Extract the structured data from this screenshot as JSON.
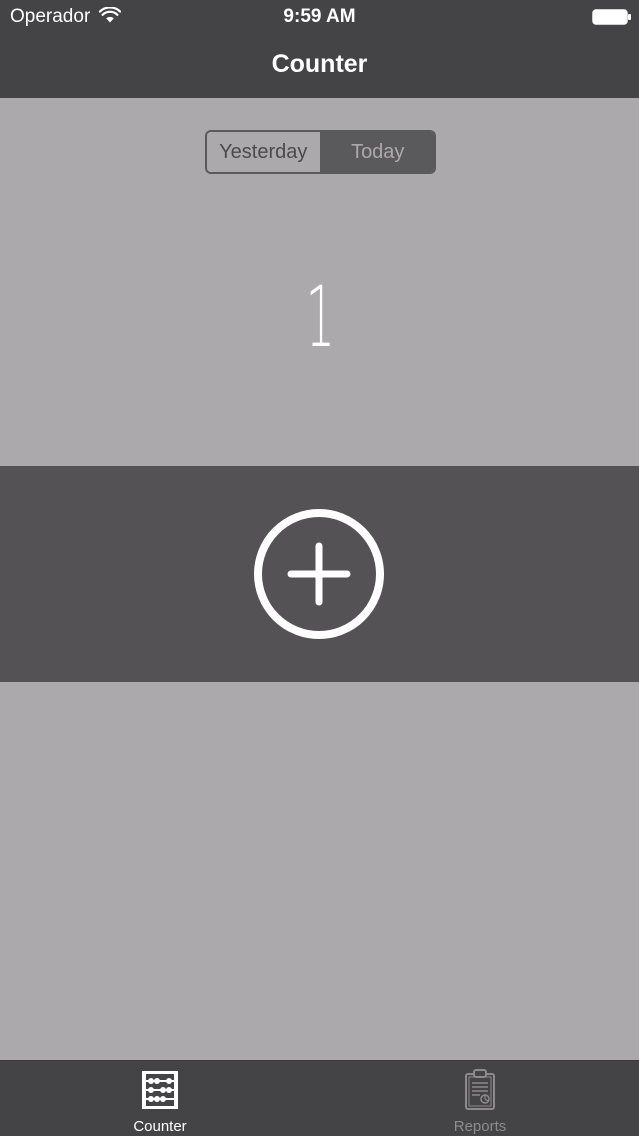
{
  "status_bar": {
    "carrier": "Operador",
    "time": "9:59 AM"
  },
  "nav": {
    "title": "Counter"
  },
  "segmented_control": {
    "options": [
      "Yesterday",
      "Today"
    ],
    "selected": "Today"
  },
  "counter": {
    "value": "1"
  },
  "tab_bar": {
    "tabs": [
      {
        "label": "Counter",
        "icon": "abacus-icon",
        "active": true
      },
      {
        "label": "Reports",
        "icon": "clipboard-icon",
        "active": false
      }
    ]
  },
  "colors": {
    "nav_background": "#444346",
    "content_background": "#aba9ac",
    "increment_band": "#545255",
    "segment_selected": "#5a595c",
    "active_tab": "#ffffff",
    "inactive_tab": "#8d8b8e"
  }
}
